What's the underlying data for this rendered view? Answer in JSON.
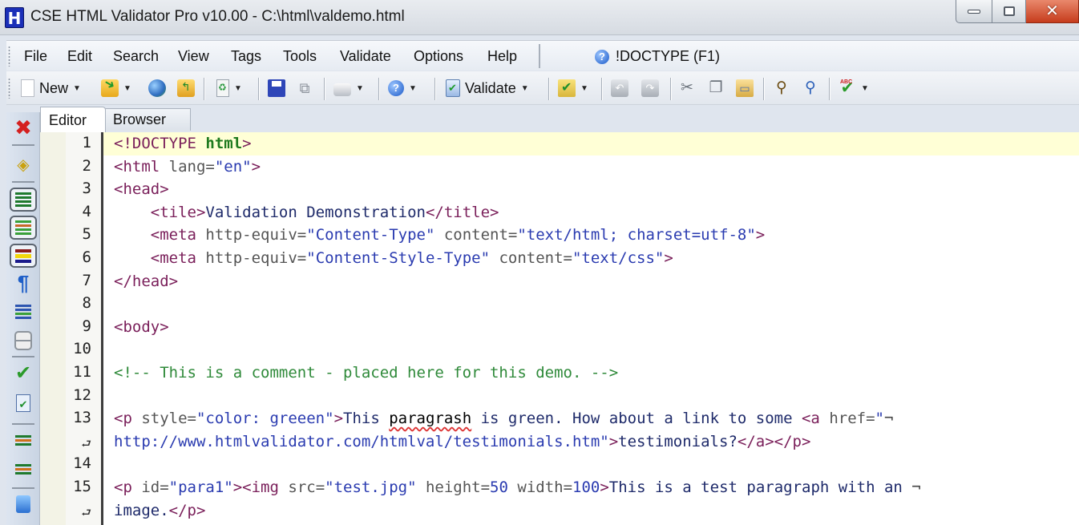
{
  "window": {
    "title": "CSE HTML Validator Pro v10.00 - C:\\html\\valdemo.html",
    "logo_letter": "H",
    "controls": {
      "minimize": "minimize",
      "maximize": "maximize",
      "close": "✕"
    }
  },
  "menu": {
    "items": [
      "File",
      "Edit",
      "Search",
      "View",
      "Tags",
      "Tools",
      "Validate",
      "Options",
      "Help"
    ],
    "context_help": "!DOCTYPE (F1)",
    "context_help_icon": "?"
  },
  "toolbar": {
    "new_label": "New",
    "validate_label": "Validate",
    "icons": [
      "new-document-icon",
      "open-folder-icon",
      "open-url-icon",
      "parent-folder-icon",
      "reload-icon",
      "save-icon",
      "save-all-icon",
      "print-icon",
      "help-icon",
      "validate-icon",
      "tasks-icon",
      "undo-icon",
      "redo-icon",
      "cut-icon",
      "copy-icon",
      "paste-icon",
      "find-icon",
      "replace-icon",
      "spell-check-icon"
    ],
    "dropdown_glyph": "▼"
  },
  "side_toolbar": {
    "icons": [
      "close-icon",
      "gem-icon",
      "numbered-list-icon",
      "indent-list-icon",
      "color-bars-icon",
      "pilcrow-icon",
      "word-wrap-icon",
      "panels-icon",
      "spell-check-icon",
      "checklist-icon",
      "tag-tree-icon",
      "tag-tree-2-icon",
      "computer-icon"
    ],
    "close_glyph": "✖",
    "pilcrow_glyph": "¶"
  },
  "tabs": [
    {
      "label": "Editor",
      "active": true
    },
    {
      "label": "Browser",
      "active": false
    }
  ],
  "editor": {
    "gutter": [
      "1",
      "2",
      "3",
      "4",
      "5",
      "6",
      "7",
      "8",
      "9",
      "10",
      "11",
      "12",
      "13",
      "⮐",
      "14",
      "15",
      "⮐"
    ],
    "current_line": 1,
    "lines": [
      {
        "parts": [
          [
            "t",
            "<!DOCTYPE "
          ],
          [
            "kw",
            "html"
          ],
          [
            "t",
            ">"
          ]
        ]
      },
      {
        "parts": [
          [
            "t",
            "<html "
          ],
          [
            "a",
            "lang="
          ],
          [
            "v",
            "\"en\""
          ],
          [
            "t",
            ">"
          ]
        ]
      },
      {
        "parts": [
          [
            "t",
            "<head>"
          ]
        ]
      },
      {
        "parts": [
          [
            "tx",
            "    "
          ],
          [
            "t",
            "<tile>"
          ],
          [
            "tx",
            "Validation Demonstration"
          ],
          [
            "t",
            "</title>"
          ]
        ]
      },
      {
        "parts": [
          [
            "tx",
            "    "
          ],
          [
            "t",
            "<meta "
          ],
          [
            "a",
            "http-equiv="
          ],
          [
            "v",
            "\"Content-Type\""
          ],
          [
            "a",
            " content="
          ],
          [
            "v",
            "\"text/html; charset=utf-8\""
          ],
          [
            "t",
            ">"
          ]
        ]
      },
      {
        "parts": [
          [
            "tx",
            "    "
          ],
          [
            "t",
            "<meta "
          ],
          [
            "a",
            "http-equiv="
          ],
          [
            "v",
            "\"Content-Style-Type\""
          ],
          [
            "a",
            " content="
          ],
          [
            "v",
            "\"text/css\""
          ],
          [
            "t",
            ">"
          ]
        ]
      },
      {
        "parts": [
          [
            "t",
            "</head>"
          ]
        ]
      },
      {
        "parts": []
      },
      {
        "parts": [
          [
            "t",
            "<body>"
          ]
        ]
      },
      {
        "parts": []
      },
      {
        "parts": [
          [
            "c",
            "<!-- This is a comment - placed here for this demo. -->"
          ]
        ]
      },
      {
        "parts": []
      },
      {
        "parts": [
          [
            "t",
            "<p "
          ],
          [
            "a",
            "style="
          ],
          [
            "v",
            "\"color: greeen\""
          ],
          [
            "t",
            ">"
          ],
          [
            "tx",
            "This "
          ],
          [
            "squig",
            "paragrash"
          ],
          [
            "tx",
            " is green. How about a link to some "
          ],
          [
            "t",
            "<a "
          ],
          [
            "a",
            "href="
          ],
          [
            "v",
            "\""
          ],
          [
            "wrapmark",
            "¬"
          ]
        ]
      },
      {
        "parts": [
          [
            "v",
            "http://www.htmlvalidator.com/htmlval/testimonials.htm\""
          ],
          [
            "t",
            ">"
          ],
          [
            "tx",
            "testimonials?"
          ],
          [
            "t",
            "</a></p>"
          ]
        ]
      },
      {
        "parts": []
      },
      {
        "parts": [
          [
            "t",
            "<p "
          ],
          [
            "a",
            "id="
          ],
          [
            "v",
            "\"para1\""
          ],
          [
            "t",
            "><img "
          ],
          [
            "a",
            "src="
          ],
          [
            "v",
            "\"test.jpg\""
          ],
          [
            "a",
            " height="
          ],
          [
            "num",
            "50"
          ],
          [
            "a",
            " width="
          ],
          [
            "num",
            "100"
          ],
          [
            "t",
            ">"
          ],
          [
            "tx",
            "This is a test paragraph with an "
          ],
          [
            "wrapmark",
            "¬"
          ]
        ]
      },
      {
        "parts": [
          [
            "tx",
            "image."
          ],
          [
            "t",
            "</p>"
          ]
        ]
      }
    ]
  }
}
